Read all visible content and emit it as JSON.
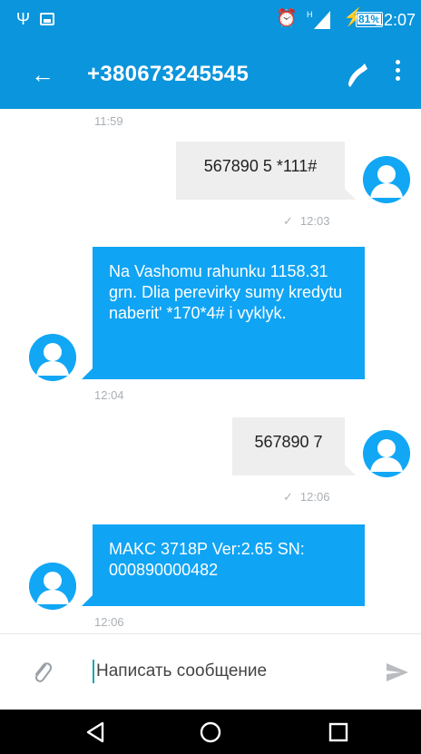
{
  "status_bar": {
    "usb_icon": "usb-icon",
    "image_icon": "image-icon",
    "alarm_icon": "alarm-icon",
    "network_type": "H",
    "battery_percent": "81%",
    "time": "12:07",
    "color": "#0a95dc"
  },
  "app_bar": {
    "title": "+380673245545",
    "back_icon": "back-arrow-icon",
    "call_icon": "phone-icon",
    "menu_icon": "more-vert-icon",
    "color": "#0a95dc"
  },
  "messages": [
    {
      "type": "timestamp",
      "time": "11:59"
    },
    {
      "type": "outgoing",
      "text": "567890 5 *111#",
      "time": "12:03",
      "status": "sent"
    },
    {
      "type": "incoming",
      "text": "Na Vashomu rahunku 1158.31 grn. Dlia perevirky sumy kredytu naberit' *170*4# i vyklyk.",
      "time": "12:04"
    },
    {
      "type": "outgoing",
      "text": "567890 7",
      "time": "12:06",
      "status": "sent"
    },
    {
      "type": "incoming",
      "text": "MAKC 3718P Ver:2.65 SN: 000890000482",
      "time": "12:06"
    }
  ],
  "compose": {
    "placeholder": "Написать сообщение",
    "attach_icon": "paperclip-icon",
    "send_icon": "send-icon"
  },
  "nav_bar": {
    "back": "nav-back-icon",
    "home": "nav-home-icon",
    "recents": "nav-recents-icon"
  },
  "colors": {
    "incoming_bubble": "#10a4f4",
    "outgoing_bubble": "#eeeeee"
  }
}
